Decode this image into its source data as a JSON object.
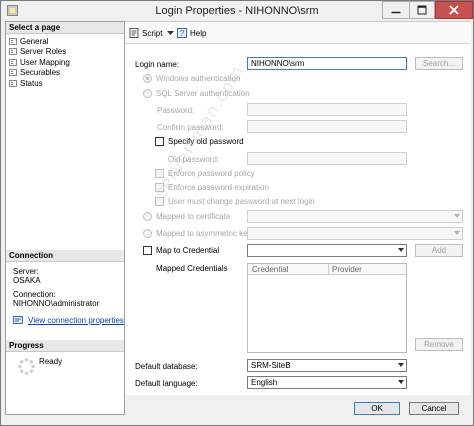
{
  "window": {
    "title": "Login Properties - NIHONNO\\srm"
  },
  "left_pane": {
    "select_page_header": "Select a page",
    "pages": [
      {
        "label": "General"
      },
      {
        "label": "Server Roles"
      },
      {
        "label": "User Mapping"
      },
      {
        "label": "Securables"
      },
      {
        "label": "Status"
      }
    ],
    "connection_header": "Connection",
    "server_label": "Server:",
    "server_value": "OSAKA",
    "connection_label": "Connection:",
    "connection_value": "NIHONNO\\administrator",
    "view_connection_properties": "View connection properties",
    "progress_header": "Progress",
    "progress_status": "Ready"
  },
  "toolbar": {
    "script_label": "Script",
    "help_label": "Help"
  },
  "general": {
    "login_name_label": "Login name:",
    "login_name_value": "NIHONNO\\srm",
    "search_button": "Search...",
    "windows_auth_label": "Windows authentication",
    "sql_auth_label": "SQL Server authentication",
    "password_label": "Password:",
    "confirm_password_label": "Confirm password:",
    "specify_old_password_label": "Specify old password",
    "old_password_label": "Old password:",
    "enforce_policy_label": "Enforce password policy",
    "enforce_expiration_label": "Enforce password expiration",
    "must_change_label": "User must change password at next login",
    "mapped_cert_label": "Mapped to certificate",
    "mapped_asym_label": "Mapped to asymmetric key",
    "map_credential_label": "Map to Credential",
    "add_button": "Add",
    "mapped_credentials_label": "Mapped Credentials",
    "grid_columns": [
      "Credential",
      "Provider"
    ],
    "remove_button": "Remove",
    "default_database_label": "Default database:",
    "default_database_value": "SRM-SiteB",
    "default_language_label": "Default language:",
    "default_language_value": "English"
  },
  "footer": {
    "ok_button": "OK",
    "cancel_button": "Cancel"
  },
  "watermark": "server-man.com"
}
